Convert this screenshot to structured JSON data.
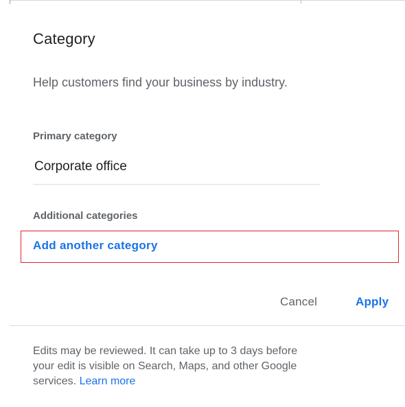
{
  "dialog": {
    "title": "Category",
    "subtitle": "Help customers find your business by industry."
  },
  "primary_category": {
    "label": "Primary category",
    "value": "Corporate office"
  },
  "additional_categories": {
    "label": "Additional categories",
    "add_link": "Add another category"
  },
  "actions": {
    "cancel": "Cancel",
    "apply": "Apply"
  },
  "footer": {
    "line1": "Edits may be reviewed. It can take up to 3 days before",
    "line2": "your edit is visible on Search, Maps, and other Google",
    "line3_prefix": "services.",
    "learn_more": "Learn more"
  },
  "colors": {
    "accent": "#1a73e8",
    "highlight_border": "#e0242a",
    "secondary_text": "#5f6368"
  }
}
